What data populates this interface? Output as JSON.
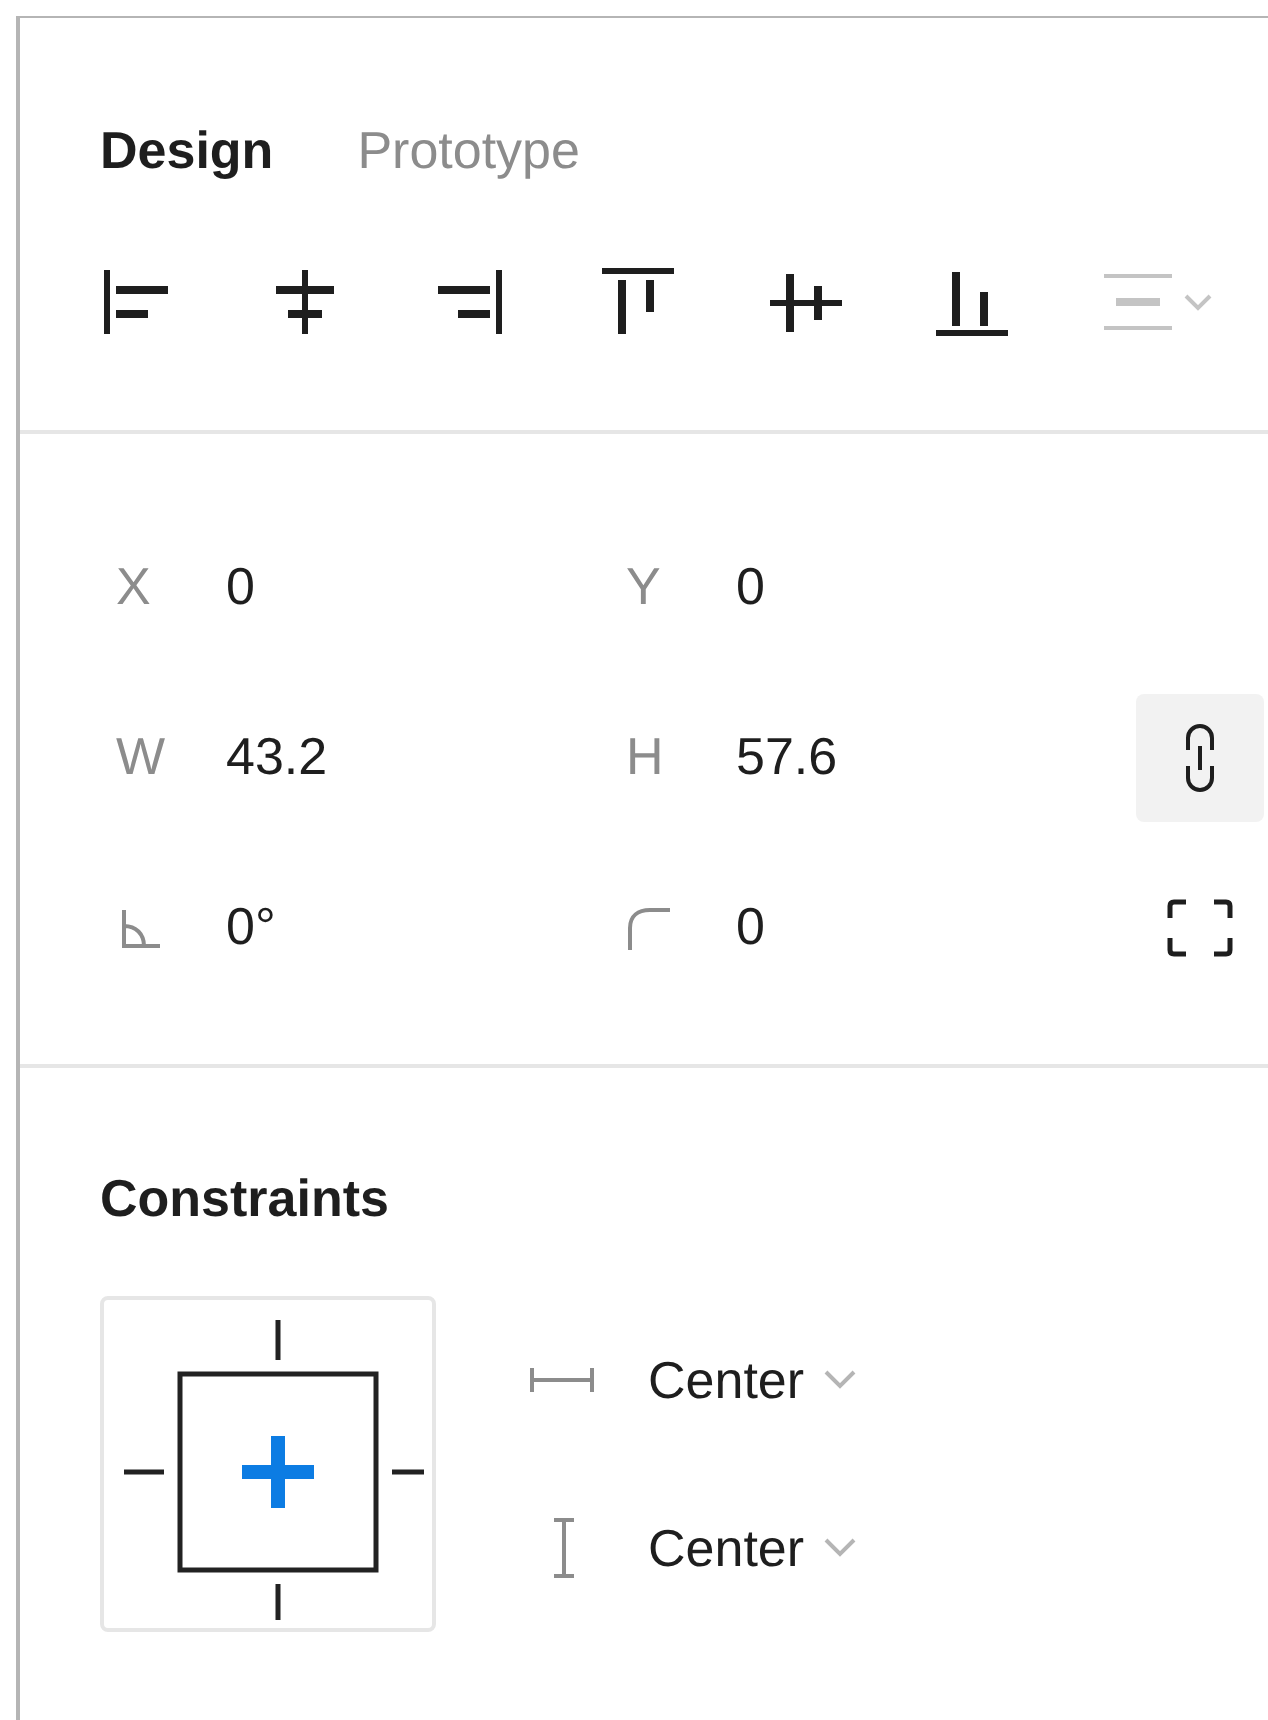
{
  "tabs": [
    {
      "label": "Design",
      "selected": true
    },
    {
      "label": "Prototype",
      "selected": false
    }
  ],
  "align_tools": [
    {
      "kind": "align-left",
      "disabled": false
    },
    {
      "kind": "align-hcenter",
      "disabled": false
    },
    {
      "kind": "align-right",
      "disabled": false
    },
    {
      "kind": "align-top",
      "disabled": false
    },
    {
      "kind": "align-vcenter",
      "disabled": false
    },
    {
      "kind": "align-bottom",
      "disabled": false
    },
    {
      "kind": "distribute",
      "disabled": true
    }
  ],
  "properties": [
    {
      "kind": "text",
      "label": "X",
      "value": "0"
    },
    {
      "kind": "text",
      "label": "Y",
      "value": "0"
    },
    {
      "kind": "text",
      "label": "W",
      "value": "43.2"
    },
    {
      "kind": "text",
      "label": "H",
      "value": "57.6"
    },
    {
      "kind": "rotation",
      "value": "0°"
    },
    {
      "kind": "radius",
      "value": "0"
    }
  ],
  "constrain_proportions": {
    "on": true
  },
  "constraints": {
    "title": "Constraints",
    "horizontal": "Center",
    "vertical": "Center"
  }
}
